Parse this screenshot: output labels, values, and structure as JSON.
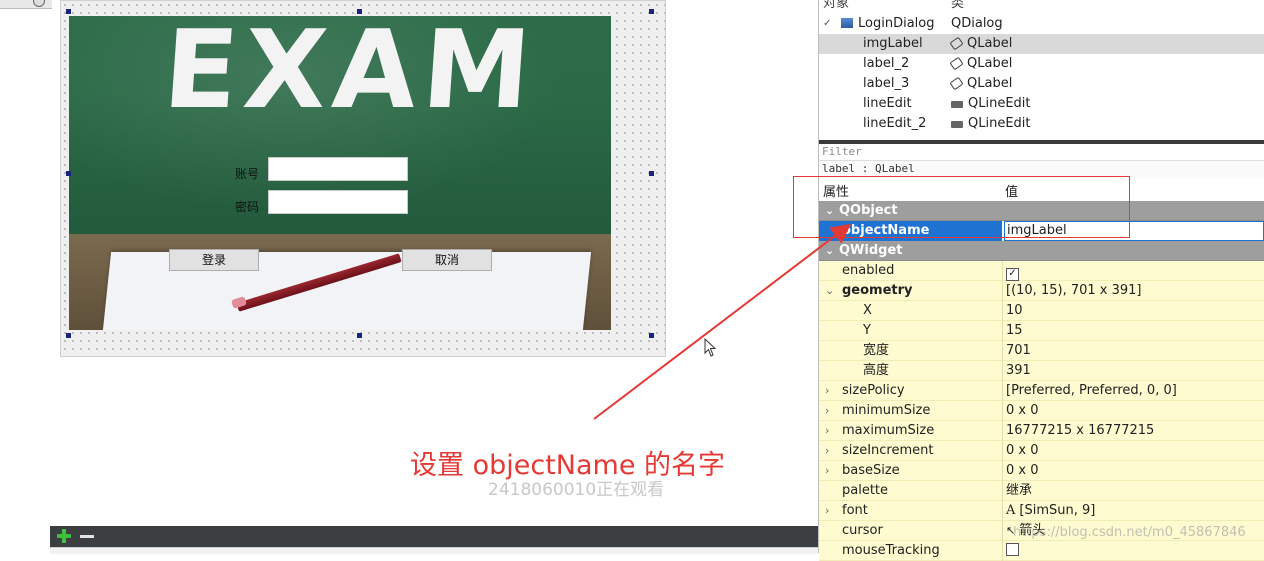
{
  "form": {
    "exam_title": "EXAM",
    "account_label": "账号",
    "password_label": "密码",
    "login_button": "登录",
    "cancel_button": "取消"
  },
  "annotation": {
    "text": "设置 objectName 的名字",
    "color": "#e53935"
  },
  "viewer_watermark": "2418060010正在观看",
  "csdn_watermark": "https://blog.csdn.net/m0_45867846",
  "object_inspector": {
    "col_object": "对象",
    "col_class": "类",
    "rows": [
      {
        "name": "LoginDialog",
        "class": "QDialog",
        "icon": "dialog-icon"
      },
      {
        "name": "imgLabel",
        "class": "QLabel",
        "icon": "label-icon"
      },
      {
        "name": "label_2",
        "class": "QLabel",
        "icon": "label-icon"
      },
      {
        "name": "label_3",
        "class": "QLabel",
        "icon": "label-icon"
      },
      {
        "name": "lineEdit",
        "class": "QLineEdit",
        "icon": "lineedit-icon"
      },
      {
        "name": "lineEdit_2",
        "class": "QLineEdit",
        "icon": "lineedit-icon"
      }
    ]
  },
  "property_editor": {
    "filter_placeholder": "Filter",
    "class_line": "label : QLabel",
    "col_property": "属性",
    "col_value": "值",
    "groups": {
      "qobject": "QObject",
      "qwidget": "QWidget"
    },
    "object_name": {
      "name": "objectName",
      "value": "imgLabel"
    },
    "enabled": {
      "name": "enabled",
      "checked": true
    },
    "geometry": {
      "name": "geometry",
      "value": "[(10, 15), 701 x 391]"
    },
    "x": {
      "name": "X",
      "value": "10"
    },
    "y": {
      "name": "Y",
      "value": "15"
    },
    "width": {
      "name": "宽度",
      "value": "701"
    },
    "height": {
      "name": "高度",
      "value": "391"
    },
    "size_policy": {
      "name": "sizePolicy",
      "value": "[Preferred, Preferred, 0, 0]"
    },
    "minimum_size": {
      "name": "minimumSize",
      "value": "0 x 0"
    },
    "maximum_size": {
      "name": "maximumSize",
      "value": "16777215 x 16777215"
    },
    "size_increment": {
      "name": "sizeIncrement",
      "value": "0 x 0"
    },
    "base_size": {
      "name": "baseSize",
      "value": "0 x 0"
    },
    "palette": {
      "name": "palette",
      "value": "继承"
    },
    "font": {
      "name": "font",
      "value": "[SimSun, 9]"
    },
    "cursor": {
      "name": "cursor",
      "value": "箭头"
    },
    "mouse_tracking": {
      "name": "mouseTracking",
      "checked": false
    }
  }
}
